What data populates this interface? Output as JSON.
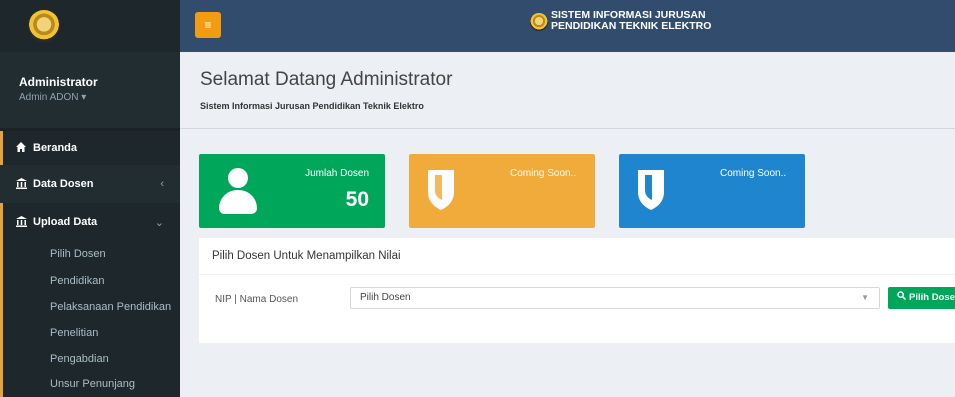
{
  "sidebar": {
    "user_name": "Administrator",
    "user_role": "Admin ADON ▾",
    "nav": {
      "beranda": {
        "icon": "home-icon",
        "label": "Beranda"
      },
      "data_dosen": {
        "icon": "institution-icon",
        "label": "Data Dosen",
        "caret": "‹"
      },
      "upload_data": {
        "icon": "institution-icon",
        "label": "Upload Data",
        "caret": "⌄"
      }
    },
    "submenu": [
      "Pilih Dosen",
      "Pendidikan",
      "Pelaksanaan Pendidikan",
      "Penelitian",
      "Pengabdian",
      "Unsur Penunjang"
    ]
  },
  "header": {
    "menu_toggle_icon": "≡",
    "title_line1": "SISTEM INFORMASI JURUSAN",
    "title_line2": "PENDIDIKAN TEKNIK ELEKTRO"
  },
  "page": {
    "title": "Selamat Datang Administrator",
    "subtitle": "Sistem Informasi Jurusan Pendidikan Teknik Elektro"
  },
  "info_boxes": [
    {
      "label": "Jumlah Dosen",
      "value": "50",
      "icon": "user-icon",
      "color": "#00a65a"
    },
    {
      "label": "Coming Soon..",
      "value": "",
      "icon": "shield-icon",
      "color": "#f39c12"
    },
    {
      "label": "Coming Soon..",
      "value": "",
      "icon": "shield-icon",
      "color": "#1f85cf"
    }
  ],
  "panel": {
    "title": "Pilih Dosen Untuk Menampilkan Nilai",
    "field_label": "NIP | Nama Dosen",
    "select_value": "Pilih Dosen",
    "button_label": "Pilih Dosen"
  }
}
